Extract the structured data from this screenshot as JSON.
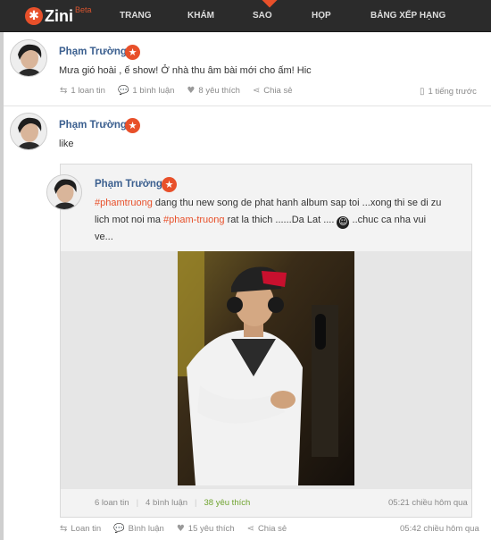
{
  "app": {
    "logo_text": "Zini",
    "logo_beta": "Beta"
  },
  "nav": {
    "items": [
      "TRANG CHỦ",
      "KHÁM PHÁ",
      "SAO VIỆT",
      "HỌP CHỢ",
      "BẢNG XẾP HẠNG"
    ],
    "active": "SAO VIỆT"
  },
  "posts": [
    {
      "author": "Phạm Trường",
      "text": "Mưa gió hoài , ế show! Ở nhà thu âm bài mới cho ấm! Hic",
      "actions": {
        "share": "1 loan tin",
        "comments": "1 bình luận",
        "likes": "8 yêu thích",
        "spread": "Chia sẻ"
      },
      "timestamp": "1 tiếng trước"
    },
    {
      "author": "Phạm Trường",
      "text": "like",
      "shared": {
        "author": "Phạm Trường",
        "hashtag1": "#phamtruong",
        "text1": " dang thu new song de phat hanh album sap toi ...xong thi se di zu",
        "text2a": "lich mot noi ma ",
        "hashtag2": "#pham-truong",
        "text2b": " rat la thich ......Da Lat .... ",
        "text2c": " ..chuc ca nha vui",
        "text3": "ve...",
        "stats": {
          "shares": "6 loan tin",
          "comments": "4 bình luận",
          "likes": "38 yêu thích"
        },
        "timestamp": "05:21 chiều hôm qua"
      },
      "actions": {
        "share": "Loan tin",
        "comments": "Bình luận",
        "likes": "15 yêu thích",
        "spread": "Chia sẻ"
      },
      "timestamp": "05:42 chiều hôm qua"
    }
  ],
  "icons": {
    "logo": "zini-logo-icon",
    "badge": "star-badge-icon",
    "retweet": "loan-tin-icon",
    "comment": "comment-icon",
    "heart": "heart-icon",
    "share": "share-icon",
    "mobile": "mobile-icon",
    "emoji": "laughing-emoji-icon"
  },
  "colors": {
    "accent": "#e8502a",
    "author": "#3b5f8f",
    "nav_bg": "#2b2b2b",
    "likes_green": "#6fa32f"
  }
}
